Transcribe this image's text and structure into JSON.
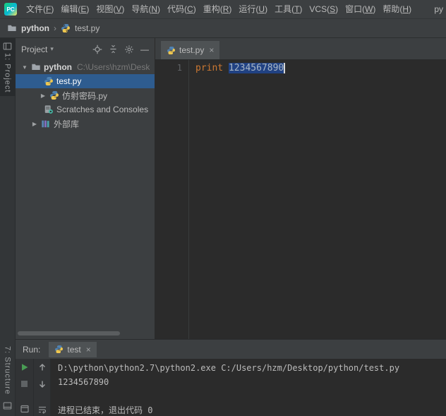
{
  "window": {
    "logo_text": "PC"
  },
  "menu_bar": {
    "items": [
      {
        "label": "文件(F)"
      },
      {
        "label": "编辑(E)"
      },
      {
        "label": "视图(V)"
      },
      {
        "label": "导航(N)"
      },
      {
        "label": "代码(C)"
      },
      {
        "label": "重构(R)"
      },
      {
        "label": "运行(U)"
      },
      {
        "label": "工具(T)"
      },
      {
        "label": "VCS(S)"
      },
      {
        "label": "窗口(W)"
      },
      {
        "label": "帮助(H)"
      }
    ],
    "overflow_text": "py"
  },
  "breadcrumbs": {
    "project": "python",
    "separator": "›",
    "file": "test.py"
  },
  "tool_stripes": {
    "project_label": "1: Project",
    "structure_label": "7: Structure"
  },
  "project_panel": {
    "title": "Project",
    "root": {
      "name": "python",
      "path": "C:\\Users\\hzm\\Desk"
    },
    "items": [
      {
        "label": "test.py"
      },
      {
        "label": "仿射密码.py"
      },
      {
        "label": "Scratches and Consoles"
      },
      {
        "label": "外部库"
      }
    ]
  },
  "editor": {
    "tab": {
      "label": "test.py"
    },
    "line_number": "1",
    "code": {
      "keyword": "print",
      "selected_text": "1234567890"
    }
  },
  "run_panel": {
    "title": "Run:",
    "tab": {
      "label": "test"
    },
    "console_lines": [
      {
        "text": "D:\\python\\python2.7\\python2.exe C:/Users/hzm/Desktop/python/test.py"
      },
      {
        "text": "1234567890"
      },
      {
        "text": "进程已结束，退出代码 0"
      }
    ]
  },
  "icons": {
    "close": "×",
    "dropdown": "▾",
    "chevron_open": "▼",
    "chevron_closed": "▶",
    "hide": "—"
  },
  "colors": {
    "selection": "#214283",
    "keyword": "#cc7832",
    "run_green": "#499c54",
    "selected_row": "#2e5c8f"
  }
}
